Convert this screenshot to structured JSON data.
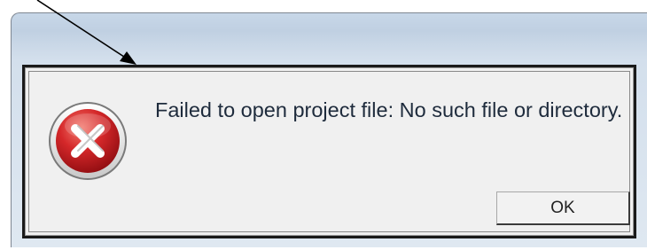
{
  "dialog": {
    "icon": "error-icon",
    "message": "Failed to open project file: No such file or directory.",
    "ok_label": "OK"
  },
  "colors": {
    "dialog_background": "#f0f0f0",
    "dialog_border": "#1a1a1a",
    "error_red": "#c0191c",
    "window_glass": "#c7d7e8"
  },
  "annotation": {
    "icon": "arrow-pointer"
  }
}
